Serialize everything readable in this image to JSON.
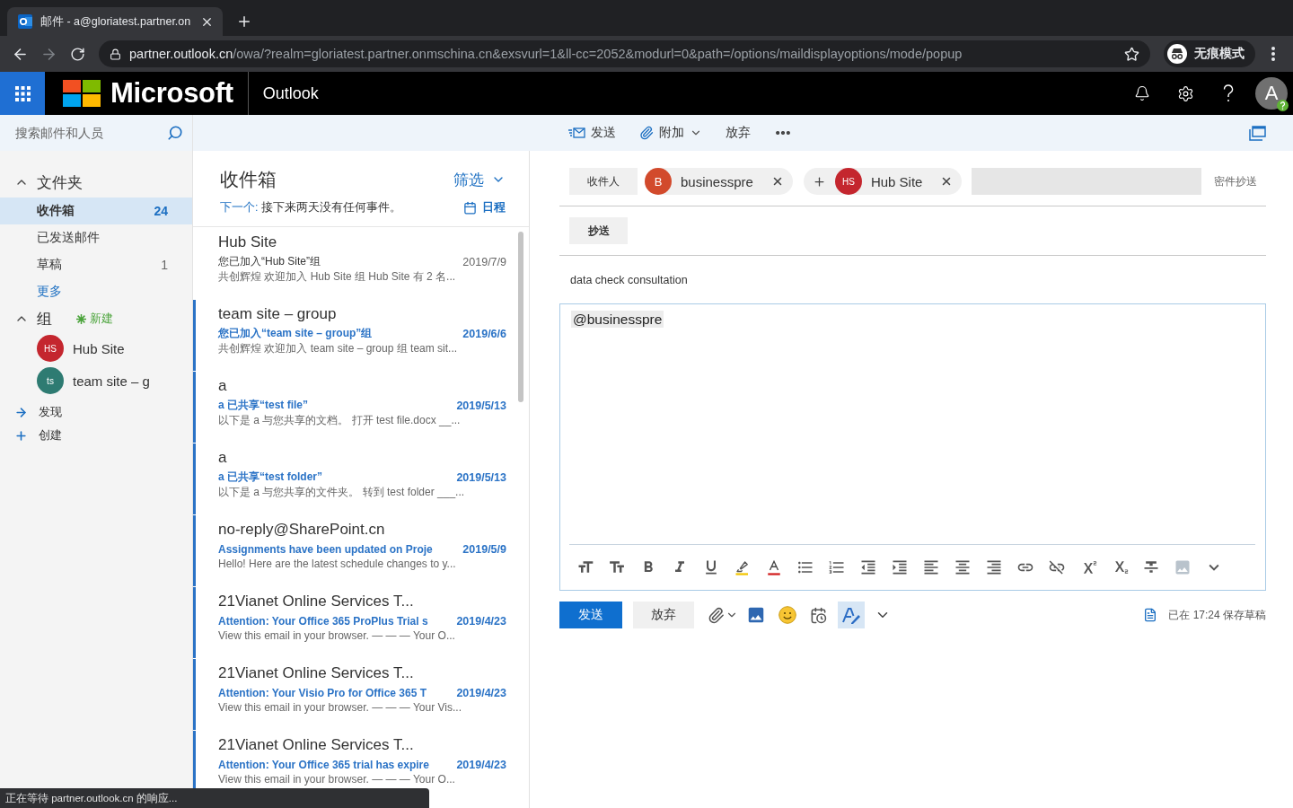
{
  "browser": {
    "tab_title": "邮件 - a@gloriatest.partner.on",
    "forward_disabled": true,
    "url_host": "partner.outlook.cn",
    "url_path": "/owa/?realm=gloriatest.partner.onmschina.cn&exsvurl=1&ll-cc=2052&modurl=0&path=/options/maildisplayoptions/mode/popup",
    "profile_label": "无痕模式"
  },
  "app_bar": {
    "brand": "Microsoft",
    "app_name": "Outlook",
    "avatar_initial": "A"
  },
  "search": {
    "placeholder": "搜索邮件和人员"
  },
  "sidebar": {
    "folders_heading": "文件夹",
    "folders_expanded": true,
    "folders": [
      {
        "label": "收件箱",
        "count": "24",
        "selected": true
      },
      {
        "label": "已发送邮件",
        "selected": false
      },
      {
        "label": "草稿",
        "count": "1",
        "selected": false
      }
    ],
    "more_link": "更多",
    "groups_heading": "组",
    "groups_expanded": true,
    "new_group": "新建",
    "groups": [
      {
        "initials": "HS",
        "label": "Hub Site",
        "color": "#c4262e"
      },
      {
        "initials": "ts",
        "label": "team site – g",
        "color": "#2e7b72"
      }
    ],
    "actions": [
      {
        "kind": "discover",
        "label": "发现"
      },
      {
        "kind": "create",
        "label": "创建"
      }
    ]
  },
  "mail_list": {
    "title": "收件箱",
    "filter": "筛选",
    "agenda_prefix": "下一个:",
    "agenda_text": "接下来两天没有任何事件。",
    "agenda_link": "日程",
    "messages": [
      {
        "sender": "Hub Site",
        "subject": "您已加入“Hub Site”组",
        "date": "2019/7/9",
        "preview": "共创辉煌 欢迎加入 Hub Site 组 Hub Site 有 2 名...",
        "unread": false
      },
      {
        "sender": "team site – group",
        "subject": "您已加入“team site – group”组",
        "date": "2019/6/6",
        "preview": "共创辉煌 欢迎加入 team site – group 组 team sit...",
        "unread": true
      },
      {
        "sender": "a",
        "subject": "a 已共享“test file”",
        "date": "2019/5/13",
        "preview": "以下是 a 与您共享的文档。 打开 test file.docx __...",
        "unread": true
      },
      {
        "sender": "a",
        "subject": "a 已共享“test folder”",
        "date": "2019/5/13",
        "preview": "以下是 a 与您共享的文件夹。 转到 test folder ___...",
        "unread": true
      },
      {
        "sender": "no-reply@SharePoint.cn",
        "subject": "Assignments have been updated on Proje",
        "date": "2019/5/9",
        "preview": "Hello! Here are the latest schedule changes to y...",
        "unread": true
      },
      {
        "sender": "21Vianet Online Services T...",
        "subject": "Attention: Your Office 365 ProPlus Trial s",
        "date": "2019/4/23",
        "preview": "View this email in your browser. — — — Your O...",
        "unread": true
      },
      {
        "sender": "21Vianet Online Services T...",
        "subject": "Attention: Your Visio Pro for Office 365 T",
        "date": "2019/4/23",
        "preview": "View this email in your browser. — — — Your Vis...",
        "unread": true
      },
      {
        "sender": "21Vianet Online Services T...",
        "subject": "Attention: Your Office 365 trial has expire",
        "date": "2019/4/23",
        "preview": "View this email in your browser. — — — Your O...",
        "unread": true
      }
    ]
  },
  "compose": {
    "toolbar": [
      {
        "kind": "send",
        "label": "发送"
      },
      {
        "kind": "attach",
        "label": "附加"
      },
      {
        "kind": "discard",
        "label": "放弃"
      },
      {
        "kind": "more"
      }
    ],
    "to_label": "收件人",
    "recipients": [
      {
        "initials": "B",
        "name": "businesspre",
        "color": "#d24a2c",
        "expandable": false
      },
      {
        "initials": "HS",
        "name": "Hub Site",
        "color": "#c4262e",
        "expandable": true
      }
    ],
    "bcc_label": "密件抄送",
    "cc_label": "抄送",
    "subject": "data check consultation",
    "body_mention": "@businesspre",
    "format_toolbar_shown": true,
    "send_button": "发送",
    "discard_button": "放弃",
    "draft_status": "已在 17:24 保存草稿"
  },
  "status_bubble": "正在等待 partner.outlook.cn 的响应..."
}
